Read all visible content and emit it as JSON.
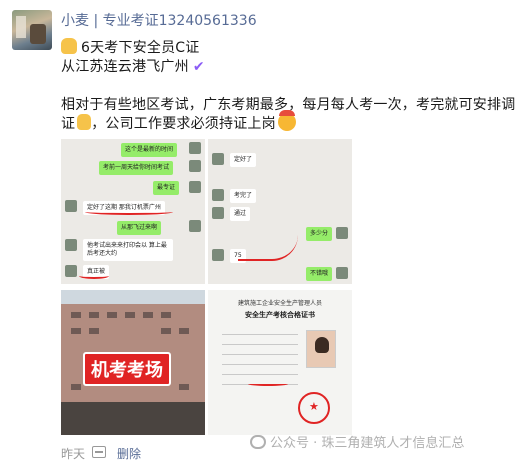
{
  "post": {
    "author": "小麦 | 专业考证13240561336",
    "line1": "6天考下安全员C证",
    "line2": "从江苏连云港飞广州",
    "line3": "相对于有些地区考试，广东考期最多，每月每人考一次，考完就可安排调",
    "line4_a": "证",
    "line4_b": "，公司工作要求必须持证上岗",
    "time": "昨天",
    "delete_label": "删除"
  },
  "photos": {
    "chat1": {
      "b1": "这个是最新的时间",
      "b2": "考前一周天给你时间考试",
      "b3": "最专证",
      "b4": "定好了这期 那我订机票广州",
      "b5": "从那飞过来啊",
      "b6": "他考试出来来打印会以 算上最后考还大约",
      "b7": "真正被"
    },
    "chat2": {
      "b1": "定好了",
      "b2": "考完了",
      "b3": "通过",
      "b4": "多少分",
      "b5": "75",
      "b6": "不错哦"
    },
    "building_tag": "机考考场",
    "certificate": {
      "header": "建筑施工企业安全生产管理人员",
      "title": "安全生产考核合格证书"
    }
  },
  "watermark": "公众号 · 珠三角建筑人才信息汇总",
  "colors": {
    "link": "#576b95",
    "bubble_green": "#95ec69",
    "accent_red": "#e02424"
  }
}
